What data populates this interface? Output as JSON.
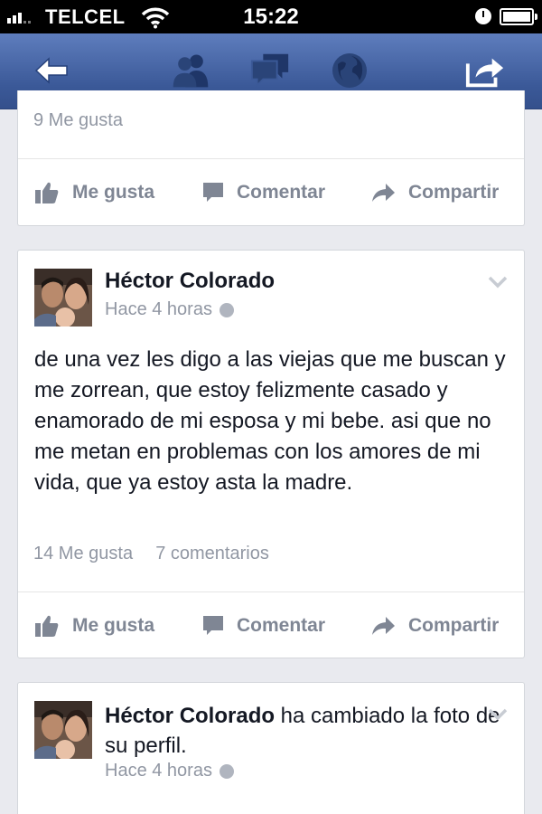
{
  "status_bar": {
    "carrier": "TELCEL",
    "time": "15:22"
  },
  "nav_bar": {
    "icons": [
      "back-arrow-icon",
      "friend-requests-icon",
      "messages-icon",
      "notifications-globe-icon",
      "share-icon"
    ]
  },
  "feed": {
    "post_top": {
      "likes": "9 Me gusta",
      "actions": {
        "like": "Me gusta",
        "comment": "Comentar",
        "share": "Compartir"
      }
    },
    "post_main": {
      "author": "Héctor Colorado",
      "timestamp": "Hace 4 horas",
      "text": "de una vez les digo a las viejas que me buscan y me zorrean, que estoy felizmente casado y enamorado de mi esposa y mi bebe. asi que no me metan en problemas con los amores de mi vida, que ya estoy asta la madre.",
      "likes": "14 Me gusta",
      "comments": "7 comentarios",
      "actions": {
        "like": "Me gusta",
        "comment": "Comentar",
        "share": "Compartir"
      }
    },
    "post_bottom": {
      "author": "Héctor Colorado",
      "story": " ha cambiado la foto de su perfil.",
      "timestamp": "Hace 4 horas"
    }
  },
  "colors": {
    "nav_blue": "#3b5998",
    "background": "#e9eaef",
    "meta_text": "#9197a3",
    "action_text": "#7f8694"
  }
}
